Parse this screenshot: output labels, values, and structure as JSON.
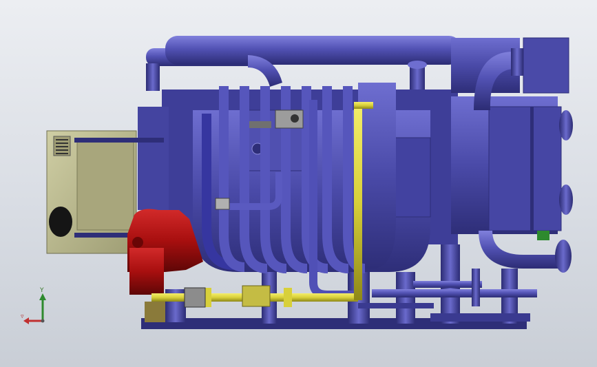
{
  "viewport": {
    "background_top": "#eceef2",
    "background_bottom": "#c9ced6"
  },
  "model": {
    "body_color": "#4a4aa8",
    "body_dark": "#2e2e78",
    "body_light": "#6e6ed0",
    "panel_color": "#b9b88c",
    "burner_color": "#a80f0f",
    "pipe_yellow": "#d8d03a",
    "valve_green": "#2e8a2e"
  },
  "triad": {
    "y_label": "Y",
    "x_color": "#c03030",
    "y_color": "#2e8a2e"
  }
}
